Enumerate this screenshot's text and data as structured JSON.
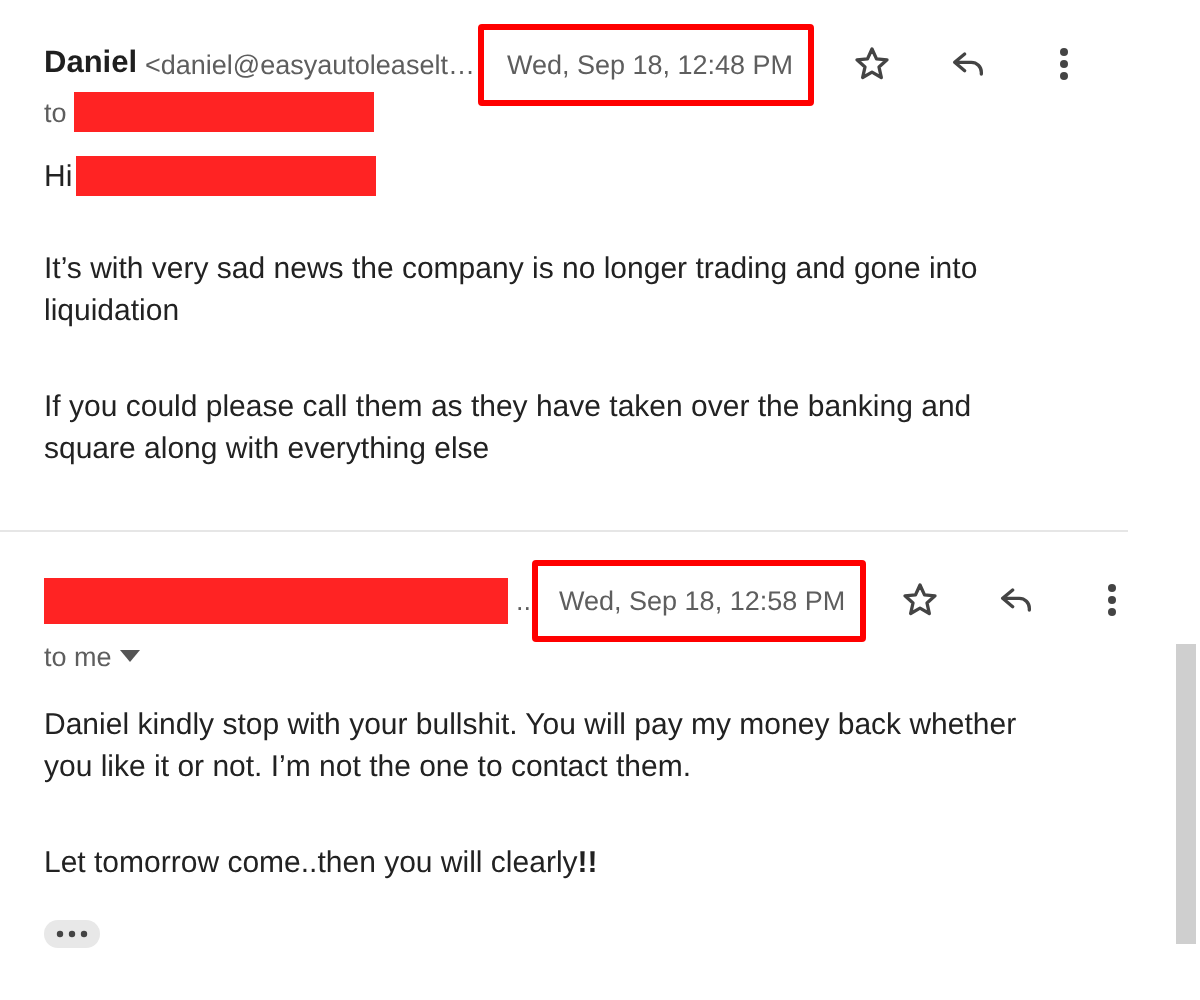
{
  "messages": [
    {
      "sender": {
        "name": "Daniel",
        "email": "<daniel@easyautoleaselt…"
      },
      "date": {
        "text": "Wed, Sep 18, 12:48 PM",
        "highlighted": true
      },
      "recipient": {
        "label": "to",
        "redacted": true
      },
      "greeting": {
        "text": "Hi",
        "redacted": true
      },
      "paragraphs": [
        "It’s with very sad news the company is no longer trading and gone into liquidation",
        "If you could please call them as they have taken over the banking and square along with everything else"
      ]
    },
    {
      "sender": {
        "ellipsis": "..",
        "redacted": true
      },
      "date": {
        "text": "Wed, Sep 18, 12:58 PM",
        "highlighted": true
      },
      "recipient": {
        "label": "to me",
        "menu": true
      },
      "paragraphs": [
        "Daniel kindly stop with your bullshit. You will pay my money back whether you like it or not. I’m not the one to contact them.",
        "Let tomorrow come..then you will clearly**!!**"
      ],
      "trimmed": true
    }
  ]
}
